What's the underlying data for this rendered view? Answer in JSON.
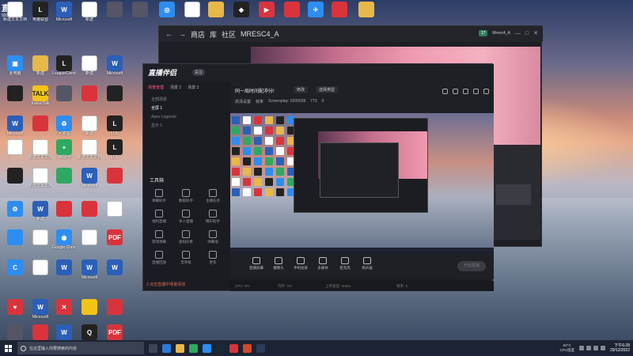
{
  "desktop": {
    "corner_logo_main": "直播",
    "corner_logo_sub": "9205839",
    "icons": [
      {
        "label": "新建文本文档",
        "color": "c-file",
        "glyph": ""
      },
      {
        "label": "英雄联盟",
        "color": "c-dark",
        "glyph": "L"
      },
      {
        "label": "Microsoft",
        "color": "c-word",
        "glyph": "W"
      },
      {
        "label": "新建",
        "color": "c-file",
        "glyph": ""
      },
      {
        "label": "",
        "color": "c-photo",
        "glyph": ""
      },
      {
        "label": "",
        "color": "c-photo",
        "glyph": ""
      },
      {
        "label": "",
        "color": "c-blue",
        "glyph": "◎"
      },
      {
        "label": "",
        "color": "c-file",
        "glyph": ""
      },
      {
        "label": "",
        "color": "c-folder",
        "glyph": ""
      },
      {
        "label": "",
        "color": "c-dark",
        "glyph": "◆"
      },
      {
        "label": "",
        "color": "c-red",
        "glyph": "▶"
      },
      {
        "label": "",
        "color": "c-red",
        "glyph": ""
      },
      {
        "label": "",
        "color": "c-blue",
        "glyph": "✈"
      },
      {
        "label": "",
        "color": "c-red",
        "glyph": ""
      },
      {
        "label": "",
        "color": "c-folder",
        "glyph": ""
      },
      {
        "label": "此电脑",
        "color": "c-blue",
        "glyph": "▣"
      },
      {
        "label": "新建",
        "color": "c-folder",
        "glyph": ""
      },
      {
        "label": "LeagueClient",
        "color": "c-dark",
        "glyph": "L"
      },
      {
        "label": "新建",
        "color": "c-file",
        "glyph": ""
      },
      {
        "label": "Microsoft",
        "color": "c-word",
        "glyph": "W"
      },
      {
        "label": "",
        "color": "c-dark",
        "glyph": ""
      },
      {
        "label": "KakaoTalk",
        "color": "c-yellow",
        "glyph": "TALK"
      },
      {
        "label": "",
        "color": "c-photo",
        "glyph": ""
      },
      {
        "label": "",
        "color": "c-red",
        "glyph": ""
      },
      {
        "label": "",
        "color": "c-dark",
        "glyph": ""
      },
      {
        "label": "Microsoft",
        "color": "c-word",
        "glyph": "W"
      },
      {
        "label": "",
        "color": "c-red",
        "glyph": ""
      },
      {
        "label": "回收站",
        "color": "c-blue",
        "glyph": "♻"
      },
      {
        "label": "新建",
        "color": "c-file",
        "glyph": ""
      },
      {
        "label": "LOL",
        "color": "c-dark",
        "glyph": "L"
      },
      {
        "label": "",
        "color": "c-file",
        "glyph": ""
      },
      {
        "label": "新建文本文档",
        "color": "c-file",
        "glyph": ""
      },
      {
        "label": "360安全",
        "color": "c-green",
        "glyph": "+"
      },
      {
        "label": "新建文本文档",
        "color": "c-file",
        "glyph": ""
      },
      {
        "label": "LOL",
        "color": "c-dark",
        "glyph": "L"
      },
      {
        "label": "",
        "color": "c-dark",
        "glyph": ""
      },
      {
        "label": "新建文本文档",
        "color": "c-file",
        "glyph": ""
      },
      {
        "label": "",
        "color": "c-green",
        "glyph": ""
      },
      {
        "label": "Microsoft",
        "color": "c-word",
        "glyph": "W"
      },
      {
        "label": "",
        "color": "c-red",
        "glyph": ""
      },
      {
        "label": "",
        "color": "c-blue",
        "glyph": "⚙"
      },
      {
        "label": "新建",
        "color": "c-word",
        "glyph": "W"
      },
      {
        "label": "",
        "color": "c-red",
        "glyph": ""
      },
      {
        "label": "",
        "color": "c-red",
        "glyph": ""
      },
      {
        "label": "",
        "color": "c-file",
        "glyph": ""
      },
      {
        "label": "",
        "color": "c-blue",
        "glyph": ""
      },
      {
        "label": "",
        "color": "c-file",
        "glyph": ""
      },
      {
        "label": "Google Chrome",
        "color": "c-blue",
        "glyph": "◉"
      },
      {
        "label": "",
        "color": "c-file",
        "glyph": ""
      },
      {
        "label": "",
        "color": "c-red",
        "glyph": "PDF"
      },
      {
        "label": "",
        "color": "c-blue",
        "glyph": "C"
      },
      {
        "label": "",
        "color": "c-file",
        "glyph": ""
      },
      {
        "label": "",
        "color": "c-word",
        "glyph": "W"
      },
      {
        "label": "Microsoft",
        "color": "c-word",
        "glyph": "W"
      },
      {
        "label": "",
        "color": "c-word",
        "glyph": "W"
      },
      {
        "label": "",
        "color": "c-red",
        "glyph": "♥"
      },
      {
        "label": "Microsoft",
        "color": "c-word",
        "glyph": "W"
      },
      {
        "label": "",
        "color": "c-red",
        "glyph": "✕"
      },
      {
        "label": "",
        "color": "c-yellow",
        "glyph": ""
      },
      {
        "label": "",
        "color": "c-red",
        "glyph": ""
      },
      {
        "label": "",
        "color": "c-photo",
        "glyph": ""
      },
      {
        "label": "",
        "color": "c-red",
        "glyph": ""
      },
      {
        "label": "Microsoft",
        "color": "c-word",
        "glyph": "W"
      },
      {
        "label": "腾讯QQ",
        "color": "c-dark",
        "glyph": "Q"
      },
      {
        "label": "",
        "color": "c-red",
        "glyph": "PDF"
      },
      {
        "label": "新建文本文档",
        "color": "c-file",
        "glyph": ""
      },
      {
        "label": "",
        "color": "c-word",
        "glyph": "W"
      },
      {
        "label": "",
        "color": "c-dark",
        "glyph": "◎"
      },
      {
        "label": "",
        "color": "c-file",
        "glyph": ""
      },
      {
        "label": "",
        "color": "c-blue",
        "glyph": "▲"
      },
      {
        "label": "",
        "color": "c-blue",
        "glyph": "▲"
      },
      {
        "label": "",
        "color": "c-file",
        "glyph": ""
      },
      {
        "label": "",
        "color": "c-word",
        "glyph": "W"
      },
      {
        "label": "",
        "color": "c-red",
        "glyph": "PDF"
      },
      {
        "label": "",
        "color": "c-dark",
        "glyph": "◆"
      },
      {
        "label": "",
        "color": "c-red",
        "glyph": ""
      }
    ]
  },
  "store_window": {
    "back": "←",
    "forward": "→",
    "tab_store": "商店",
    "tab_library": "库",
    "tab_community": "社区",
    "username": "MRESC4_A",
    "badge": "17",
    "account": "Mresc4_A",
    "colors": {
      "accent": "#2f7d5a"
    }
  },
  "live_window": {
    "brand": "直播伴侣",
    "brand_badge": "关注",
    "tabs": [
      "场景管理",
      "场景 2",
      "场景 3"
    ],
    "scenes": [
      "全部场景",
      "全屏 1",
      "Apex Legends",
      "显示 1"
    ],
    "tools_title": "工具箱",
    "tools": [
      {
        "label": "弹幕助手"
      },
      {
        "label": "数据助手"
      },
      {
        "label": "主播任务"
      },
      {
        "label": "福利直播"
      },
      {
        "label": "本人直播"
      },
      {
        "label": "精彩助手"
      },
      {
        "label": "游戏弹幕"
      },
      {
        "label": "虚拟形象"
      },
      {
        "label": "弹幕墙"
      },
      {
        "label": "直播回放"
      },
      {
        "label": "音效板"
      },
      {
        "label": "更多"
      }
    ],
    "hint": "2.点击直播中场景添加",
    "head_title": "同一局时间配冲分!",
    "head_chip1": "修改",
    "head_chip2": "选择类型",
    "head_sub": [
      "高清设置",
      "帧率",
      "Screenplay: 9205539",
      "773",
      "0"
    ],
    "controls": [
      {
        "label": "直播屏幕"
      },
      {
        "label": "摄像头"
      },
      {
        "label": "手机投屏"
      },
      {
        "label": "多媒体"
      },
      {
        "label": "麦克风"
      },
      {
        "label": "扬声器"
      }
    ],
    "go_live": "开始直播",
    "status": [
      "CPU: 0%",
      "内存: 0%",
      "上传速度: 0KB/s",
      "帧率: 0"
    ],
    "colors": {
      "accent": "#ff5a8a"
    }
  },
  "taskbar": {
    "search_placeholder": "在这里输入你要搜索的内容",
    "weather": "63°C",
    "weather_sub": "CPU温度",
    "time": "下午6:28",
    "date": "29/12/2022",
    "pinned": [
      {
        "name": "task-view",
        "color": "#3c4455"
      },
      {
        "name": "edge",
        "color": "#2b7bd8"
      },
      {
        "name": "explorer",
        "color": "#e8b84a"
      },
      {
        "name": "wechat",
        "color": "#2fa862"
      },
      {
        "name": "qq",
        "color": "#2d8df0"
      },
      {
        "name": "steam",
        "color": "#1b2838"
      },
      {
        "name": "app",
        "color": "#d9343b"
      },
      {
        "name": "app2",
        "color": "#d04a2a"
      },
      {
        "name": "app3",
        "color": "#2b3b5a"
      }
    ]
  }
}
